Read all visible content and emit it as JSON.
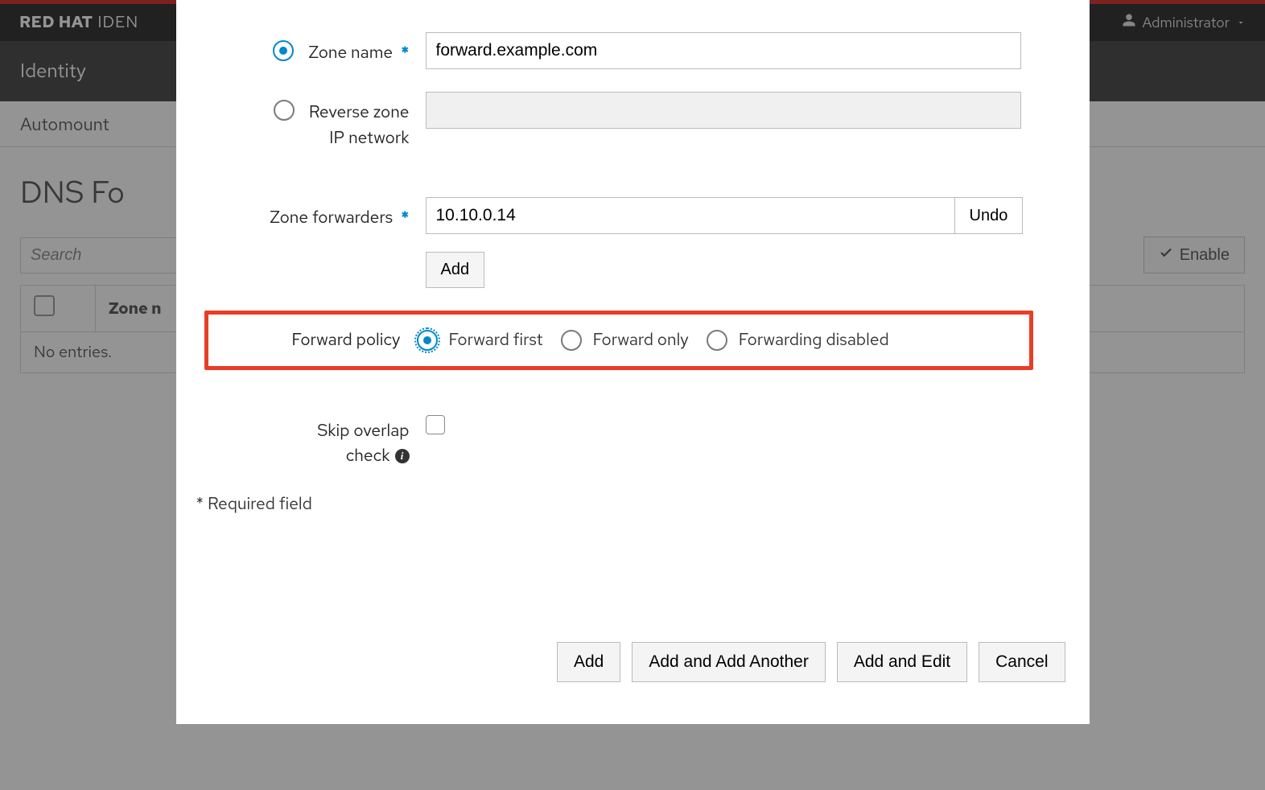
{
  "brand": {
    "red": "RED HAT",
    "suffix": "IDEN"
  },
  "adminMenu": {
    "label": "Administrator"
  },
  "nav": {
    "identity": "Identity"
  },
  "subnav": {
    "automount": "Automount"
  },
  "page": {
    "title": "DNS Fo",
    "search_placeholder": "Search",
    "enable_btn": "Enable",
    "table": {
      "col_zone": "Zone n",
      "empty": "No entries."
    }
  },
  "dialog": {
    "labels": {
      "zone_name": "Zone name",
      "reverse_zone_l1": "Reverse zone",
      "reverse_zone_l2": "IP network",
      "zone_forwarders": "Zone forwarders",
      "forward_policy": "Forward policy",
      "skip_overlap_l1": "Skip overlap",
      "skip_overlap_l2": "check"
    },
    "values": {
      "zone_name": "forward.example.com",
      "forwarder": "10.10.0.14"
    },
    "buttons": {
      "undo": "Undo",
      "add_small": "Add",
      "add": "Add",
      "add_another": "Add and Add Another",
      "add_edit": "Add and Edit",
      "cancel": "Cancel"
    },
    "policy": {
      "first": "Forward first",
      "only": "Forward only",
      "disabled": "Forwarding disabled"
    },
    "required_note": "* Required field",
    "asterisk": "*"
  }
}
